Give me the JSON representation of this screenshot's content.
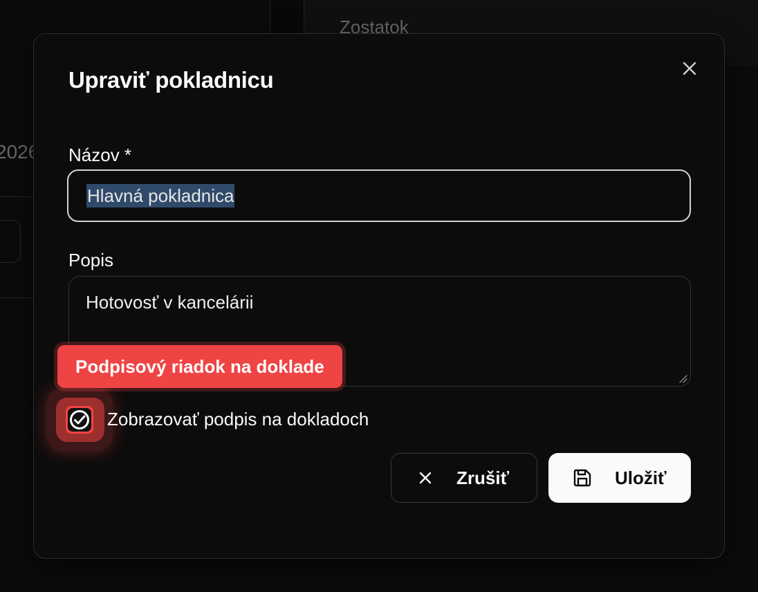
{
  "background": {
    "balance_label": "Zostatok",
    "year_fragment": "2026"
  },
  "dialog": {
    "title": "Upraviť pokladnicu",
    "close_icon": "close-icon",
    "name_field": {
      "label": "Názov *",
      "value": "Hlavná pokladnica"
    },
    "description_field": {
      "label": "Popis",
      "value": "Hotovosť v kancelárii"
    },
    "tooltip": "Podpisový riadok na doklade",
    "signature_checkbox": {
      "label": "Zobrazovať podpis na dokladoch",
      "checked": true
    },
    "buttons": {
      "cancel": {
        "label": "Zrušiť",
        "icon": "x-icon"
      },
      "save": {
        "label": "Uložiť",
        "icon": "save-icon"
      }
    }
  },
  "colors": {
    "accent_red": "#ef4444",
    "selection": "#2f4a6a",
    "background": "#0a0a0a"
  }
}
